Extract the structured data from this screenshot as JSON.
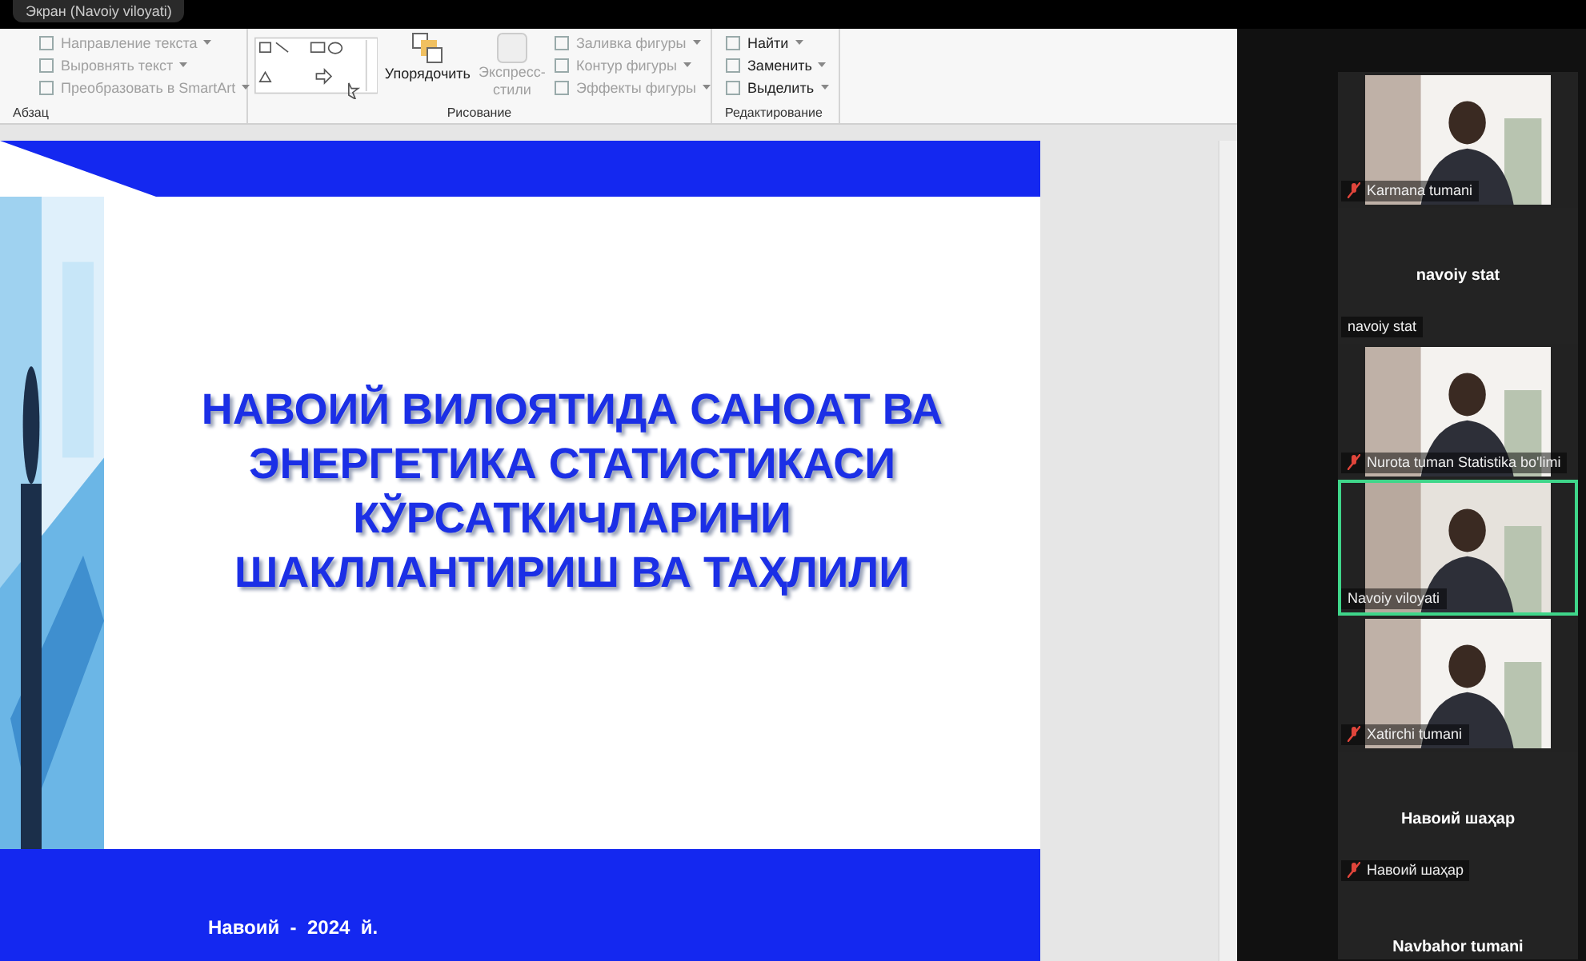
{
  "share_bar": {
    "title": "Экран (Navoiy viloyati)"
  },
  "ribbon": {
    "groups": [
      {
        "label": "Абзац",
        "items": [
          {
            "label": "Направление текста",
            "disabled": true
          },
          {
            "label": "Выровнять текст",
            "disabled": true
          },
          {
            "label": "Преобразовать в SmartArt",
            "disabled": true
          }
        ]
      },
      {
        "label": "Рисование",
        "arrange": "Упорядочить",
        "quick_styles": {
          "label": "Экспресс-стили",
          "disabled": true
        },
        "items": [
          {
            "label": "Заливка фигуры",
            "disabled": true
          },
          {
            "label": "Контур фигуры",
            "disabled": true
          },
          {
            "label": "Эффекты фигуры",
            "disabled": true
          }
        ]
      },
      {
        "label": "Редактирование",
        "items": [
          {
            "label": "Найти",
            "disabled": false
          },
          {
            "label": "Заменить",
            "disabled": false
          },
          {
            "label": "Выделить",
            "disabled": false
          }
        ]
      }
    ]
  },
  "slide": {
    "title_lines": [
      "НАВОИЙ ВИЛОЯТИДА САНОАТ ВА",
      "ЭНЕРГЕТИКА СТАТИСТИКАСИ",
      "КЎРСАТКИЧЛАРИНИ",
      "ШАКЛЛАНТИРИШ ВА ТАҲЛИЛИ"
    ],
    "footer": "Навоий  -  2024  й."
  },
  "participants": [
    {
      "kind": "video",
      "name": "Karmana tumani",
      "muted": true,
      "speaking": false
    },
    {
      "kind": "avatar",
      "display": "navoiy stat",
      "name": "navoiy stat",
      "muted": false,
      "speaking": false
    },
    {
      "kind": "video",
      "name": "Nurota tuman Statistika bo'limi",
      "muted": true,
      "speaking": false
    },
    {
      "kind": "video",
      "name": "Navoiy viloyati",
      "muted": false,
      "speaking": true
    },
    {
      "kind": "video",
      "name": "Xatirchi tumani",
      "muted": true,
      "speaking": false
    },
    {
      "kind": "avatar",
      "display": "Навоий шаҳар",
      "name": "Навоий шаҳар",
      "muted": true,
      "speaking": false
    },
    {
      "kind": "cut",
      "display": "Navbahor tumani"
    }
  ]
}
